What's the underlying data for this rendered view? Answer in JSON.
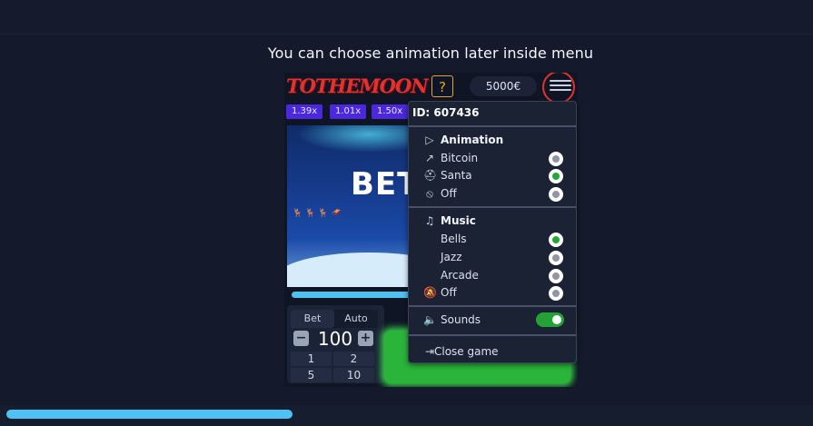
{
  "caption": "You can choose animation later inside menu",
  "header": {
    "logo_text": "TOTHEMOON",
    "help_label": "?",
    "balance": "5000€"
  },
  "multipliers": [
    "1.39x",
    "1.01x",
    "1.50x"
  ],
  "scene": {
    "banner_text": "BET"
  },
  "controls": {
    "tabs": [
      "Bet",
      "Auto"
    ],
    "minus_label": "−",
    "plus_label": "+",
    "amount": "100",
    "presets": [
      "1",
      "2",
      "5",
      "10"
    ]
  },
  "menu": {
    "id_label": "ID: 607436",
    "animation": {
      "header": "Animation",
      "options": [
        {
          "label": "Bitcoin",
          "selected": false,
          "icon": "chart-up-icon"
        },
        {
          "label": "Santa",
          "selected": true,
          "icon": "santa-hat-icon"
        },
        {
          "label": "Off",
          "selected": false,
          "icon": "ban-icon"
        }
      ]
    },
    "music": {
      "header": "Music",
      "options": [
        {
          "label": "Bells",
          "selected": true
        },
        {
          "label": "Jazz",
          "selected": false
        },
        {
          "label": "Arcade",
          "selected": false
        },
        {
          "label": "Off",
          "selected": false,
          "icon": "bell-off-icon"
        }
      ]
    },
    "sounds": {
      "label": "Sounds",
      "enabled": true
    },
    "close_label": "Close game"
  },
  "colors": {
    "accent_green": "#27a537",
    "accent_blue": "#4ec3f3",
    "highlight_red": "#e2332b",
    "multiplier_purple": "#4b27e0"
  }
}
